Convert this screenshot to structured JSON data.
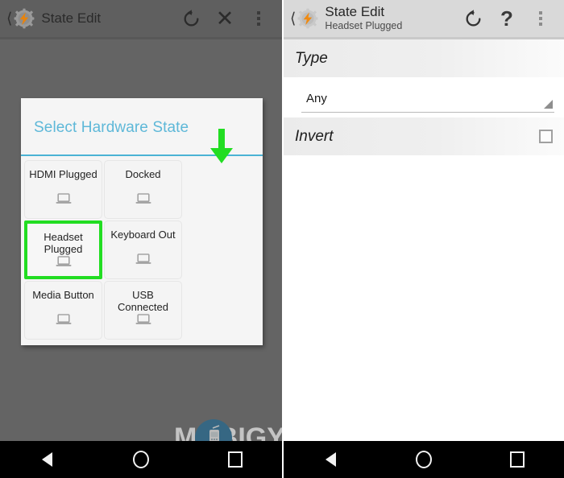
{
  "left_phone": {
    "appbar": {
      "back_icon": "back-chevron-icon",
      "app_icon": "tasker-gear-icon",
      "title": "State Edit",
      "actions": [
        {
          "name": "refresh-button",
          "icon": "refresh-icon"
        },
        {
          "name": "close-button",
          "icon": "close-icon",
          "glyph": "✕"
        },
        {
          "name": "overflow-menu-button",
          "icon": "more-vertical-icon"
        }
      ]
    },
    "dialog": {
      "title": "Select Hardware State",
      "items": [
        {
          "label": "HDMI Plugged",
          "icon": "laptop-icon",
          "selected": false
        },
        {
          "label": "Docked",
          "icon": "laptop-icon",
          "selected": false
        },
        {
          "label": "Headset Plugged",
          "icon": "laptop-icon",
          "selected": true
        },
        {
          "label": "Keyboard Out",
          "icon": "laptop-icon",
          "selected": false
        },
        {
          "label": "Media Button",
          "icon": "laptop-icon",
          "selected": false
        },
        {
          "label": "USB Connected",
          "icon": "laptop-icon",
          "selected": false
        }
      ]
    },
    "annotation": {
      "arrow_icon": "down-arrow-annotation",
      "color": "#22dd22"
    },
    "navbar": {
      "back": "nav-back-icon",
      "home": "nav-home-icon",
      "recents": "nav-recents-icon"
    }
  },
  "right_phone": {
    "appbar": {
      "back_icon": "back-chevron-icon",
      "app_icon": "tasker-gear-icon",
      "title": "State Edit",
      "subtitle": "Headset Plugged",
      "actions": [
        {
          "name": "refresh-button",
          "icon": "refresh-icon"
        },
        {
          "name": "help-button",
          "icon": "question-mark-icon",
          "glyph": "?"
        },
        {
          "name": "overflow-menu-button",
          "icon": "more-vertical-icon"
        }
      ]
    },
    "sections": [
      {
        "header": "Type",
        "field_type": "spinner",
        "value": "Any",
        "caret_icon": "dropdown-caret-icon"
      },
      {
        "header": "Invert",
        "field_type": "checkbox",
        "checked": false
      }
    ],
    "navbar": {
      "back": "nav-back-icon",
      "home": "nav-home-icon",
      "recents": "nav-recents-icon"
    }
  },
  "watermark": {
    "text": "MOBIGYAAN",
    "logo_icon": "mobigyaan-phone-logo"
  },
  "colors": {
    "accent_blue": "#4bb3d4",
    "title_blue": "#5eb8d8",
    "highlight_green": "#22dd22",
    "scrim": "#646464",
    "appbar_gray": "#d9d9d9",
    "appbar_dim": "#5f5f5f"
  }
}
